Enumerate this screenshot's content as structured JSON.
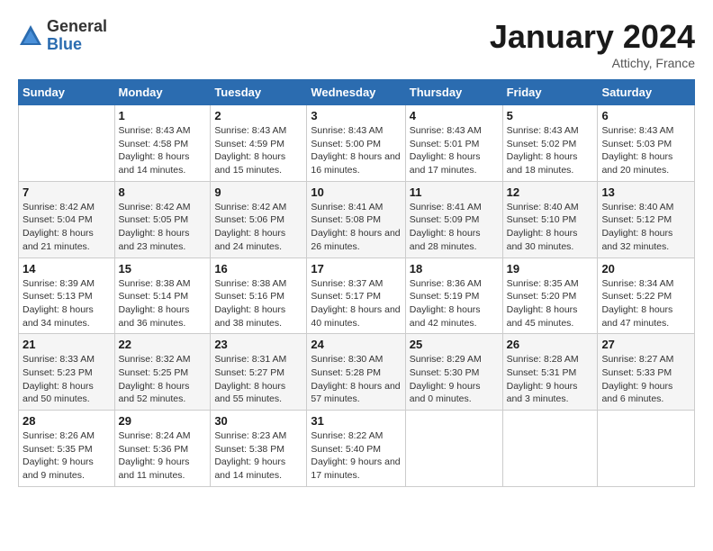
{
  "logo": {
    "general": "General",
    "blue": "Blue"
  },
  "header": {
    "month": "January 2024",
    "location": "Attichy, France"
  },
  "weekdays": [
    "Sunday",
    "Monday",
    "Tuesday",
    "Wednesday",
    "Thursday",
    "Friday",
    "Saturday"
  ],
  "weeks": [
    [
      {
        "day": "",
        "sunrise": "",
        "sunset": "",
        "daylight": ""
      },
      {
        "day": "1",
        "sunrise": "Sunrise: 8:43 AM",
        "sunset": "Sunset: 4:58 PM",
        "daylight": "Daylight: 8 hours and 14 minutes."
      },
      {
        "day": "2",
        "sunrise": "Sunrise: 8:43 AM",
        "sunset": "Sunset: 4:59 PM",
        "daylight": "Daylight: 8 hours and 15 minutes."
      },
      {
        "day": "3",
        "sunrise": "Sunrise: 8:43 AM",
        "sunset": "Sunset: 5:00 PM",
        "daylight": "Daylight: 8 hours and 16 minutes."
      },
      {
        "day": "4",
        "sunrise": "Sunrise: 8:43 AM",
        "sunset": "Sunset: 5:01 PM",
        "daylight": "Daylight: 8 hours and 17 minutes."
      },
      {
        "day": "5",
        "sunrise": "Sunrise: 8:43 AM",
        "sunset": "Sunset: 5:02 PM",
        "daylight": "Daylight: 8 hours and 18 minutes."
      },
      {
        "day": "6",
        "sunrise": "Sunrise: 8:43 AM",
        "sunset": "Sunset: 5:03 PM",
        "daylight": "Daylight: 8 hours and 20 minutes."
      }
    ],
    [
      {
        "day": "7",
        "sunrise": "Sunrise: 8:42 AM",
        "sunset": "Sunset: 5:04 PM",
        "daylight": "Daylight: 8 hours and 21 minutes."
      },
      {
        "day": "8",
        "sunrise": "Sunrise: 8:42 AM",
        "sunset": "Sunset: 5:05 PM",
        "daylight": "Daylight: 8 hours and 23 minutes."
      },
      {
        "day": "9",
        "sunrise": "Sunrise: 8:42 AM",
        "sunset": "Sunset: 5:06 PM",
        "daylight": "Daylight: 8 hours and 24 minutes."
      },
      {
        "day": "10",
        "sunrise": "Sunrise: 8:41 AM",
        "sunset": "Sunset: 5:08 PM",
        "daylight": "Daylight: 8 hours and 26 minutes."
      },
      {
        "day": "11",
        "sunrise": "Sunrise: 8:41 AM",
        "sunset": "Sunset: 5:09 PM",
        "daylight": "Daylight: 8 hours and 28 minutes."
      },
      {
        "day": "12",
        "sunrise": "Sunrise: 8:40 AM",
        "sunset": "Sunset: 5:10 PM",
        "daylight": "Daylight: 8 hours and 30 minutes."
      },
      {
        "day": "13",
        "sunrise": "Sunrise: 8:40 AM",
        "sunset": "Sunset: 5:12 PM",
        "daylight": "Daylight: 8 hours and 32 minutes."
      }
    ],
    [
      {
        "day": "14",
        "sunrise": "Sunrise: 8:39 AM",
        "sunset": "Sunset: 5:13 PM",
        "daylight": "Daylight: 8 hours and 34 minutes."
      },
      {
        "day": "15",
        "sunrise": "Sunrise: 8:38 AM",
        "sunset": "Sunset: 5:14 PM",
        "daylight": "Daylight: 8 hours and 36 minutes."
      },
      {
        "day": "16",
        "sunrise": "Sunrise: 8:38 AM",
        "sunset": "Sunset: 5:16 PM",
        "daylight": "Daylight: 8 hours and 38 minutes."
      },
      {
        "day": "17",
        "sunrise": "Sunrise: 8:37 AM",
        "sunset": "Sunset: 5:17 PM",
        "daylight": "Daylight: 8 hours and 40 minutes."
      },
      {
        "day": "18",
        "sunrise": "Sunrise: 8:36 AM",
        "sunset": "Sunset: 5:19 PM",
        "daylight": "Daylight: 8 hours and 42 minutes."
      },
      {
        "day": "19",
        "sunrise": "Sunrise: 8:35 AM",
        "sunset": "Sunset: 5:20 PM",
        "daylight": "Daylight: 8 hours and 45 minutes."
      },
      {
        "day": "20",
        "sunrise": "Sunrise: 8:34 AM",
        "sunset": "Sunset: 5:22 PM",
        "daylight": "Daylight: 8 hours and 47 minutes."
      }
    ],
    [
      {
        "day": "21",
        "sunrise": "Sunrise: 8:33 AM",
        "sunset": "Sunset: 5:23 PM",
        "daylight": "Daylight: 8 hours and 50 minutes."
      },
      {
        "day": "22",
        "sunrise": "Sunrise: 8:32 AM",
        "sunset": "Sunset: 5:25 PM",
        "daylight": "Daylight: 8 hours and 52 minutes."
      },
      {
        "day": "23",
        "sunrise": "Sunrise: 8:31 AM",
        "sunset": "Sunset: 5:27 PM",
        "daylight": "Daylight: 8 hours and 55 minutes."
      },
      {
        "day": "24",
        "sunrise": "Sunrise: 8:30 AM",
        "sunset": "Sunset: 5:28 PM",
        "daylight": "Daylight: 8 hours and 57 minutes."
      },
      {
        "day": "25",
        "sunrise": "Sunrise: 8:29 AM",
        "sunset": "Sunset: 5:30 PM",
        "daylight": "Daylight: 9 hours and 0 minutes."
      },
      {
        "day": "26",
        "sunrise": "Sunrise: 8:28 AM",
        "sunset": "Sunset: 5:31 PM",
        "daylight": "Daylight: 9 hours and 3 minutes."
      },
      {
        "day": "27",
        "sunrise": "Sunrise: 8:27 AM",
        "sunset": "Sunset: 5:33 PM",
        "daylight": "Daylight: 9 hours and 6 minutes."
      }
    ],
    [
      {
        "day": "28",
        "sunrise": "Sunrise: 8:26 AM",
        "sunset": "Sunset: 5:35 PM",
        "daylight": "Daylight: 9 hours and 9 minutes."
      },
      {
        "day": "29",
        "sunrise": "Sunrise: 8:24 AM",
        "sunset": "Sunset: 5:36 PM",
        "daylight": "Daylight: 9 hours and 11 minutes."
      },
      {
        "day": "30",
        "sunrise": "Sunrise: 8:23 AM",
        "sunset": "Sunset: 5:38 PM",
        "daylight": "Daylight: 9 hours and 14 minutes."
      },
      {
        "day": "31",
        "sunrise": "Sunrise: 8:22 AM",
        "sunset": "Sunset: 5:40 PM",
        "daylight": "Daylight: 9 hours and 17 minutes."
      },
      {
        "day": "",
        "sunrise": "",
        "sunset": "",
        "daylight": ""
      },
      {
        "day": "",
        "sunrise": "",
        "sunset": "",
        "daylight": ""
      },
      {
        "day": "",
        "sunrise": "",
        "sunset": "",
        "daylight": ""
      }
    ]
  ]
}
